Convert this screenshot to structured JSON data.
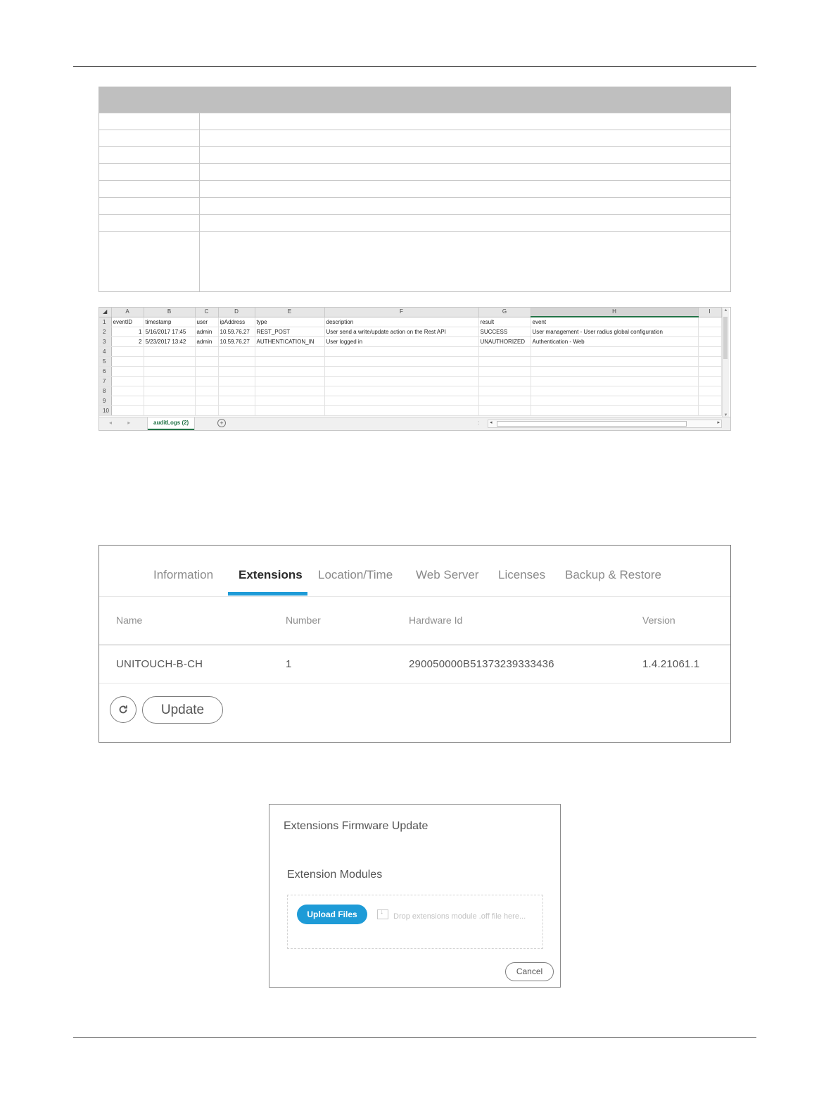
{
  "audit_sheet": {
    "column_letters": [
      "A",
      "B",
      "C",
      "D",
      "E",
      "F",
      "G",
      "H",
      "I"
    ],
    "row_numbers": [
      "1",
      "2",
      "3",
      "4",
      "5",
      "6",
      "7",
      "8",
      "9",
      "10"
    ],
    "headers": [
      "eventID",
      "timestamp",
      "user",
      "ipAddress",
      "type",
      "description",
      "result",
      "event"
    ],
    "rows": [
      [
        "1",
        "5/16/2017 17:45",
        "admin",
        "10.59.76.27",
        "REST_POST",
        "User send a write/update action on the Rest API",
        "SUCCESS",
        "User management - User radius global configuration"
      ],
      [
        "2",
        "5/23/2017 13:42",
        "admin",
        "10.59.76.27",
        "AUTHENTICATION_IN",
        "User logged in",
        "UNAUTHORIZED",
        "Authentication - Web"
      ]
    ],
    "sheet_tab": "auditLogs (2)",
    "add_sheet_symbol": "+",
    "nav_arrows": "◂ ▸",
    "scroll_dots": ":"
  },
  "extensions_panel": {
    "tabs": [
      "Information",
      "Extensions",
      "Location/Time",
      "Web Server",
      "Licenses",
      "Backup & Restore"
    ],
    "active_tab": "Extensions",
    "columns": [
      "Name",
      "Number",
      "Hardware Id",
      "Version"
    ],
    "rows": [
      {
        "name": "UNITOUCH-B-CH",
        "number": "1",
        "hardware_id": "290050000B51373239333436",
        "version": "1.4.21061.1"
      }
    ],
    "update_label": "Update",
    "accent_color": "#1e9bd7"
  },
  "firmware_dialog": {
    "title": "Extensions Firmware Update",
    "section_label": "Extension Modules",
    "upload_label": "Upload Files",
    "drop_text": "Drop extensions module .off file here...",
    "cancel_label": "Cancel"
  }
}
